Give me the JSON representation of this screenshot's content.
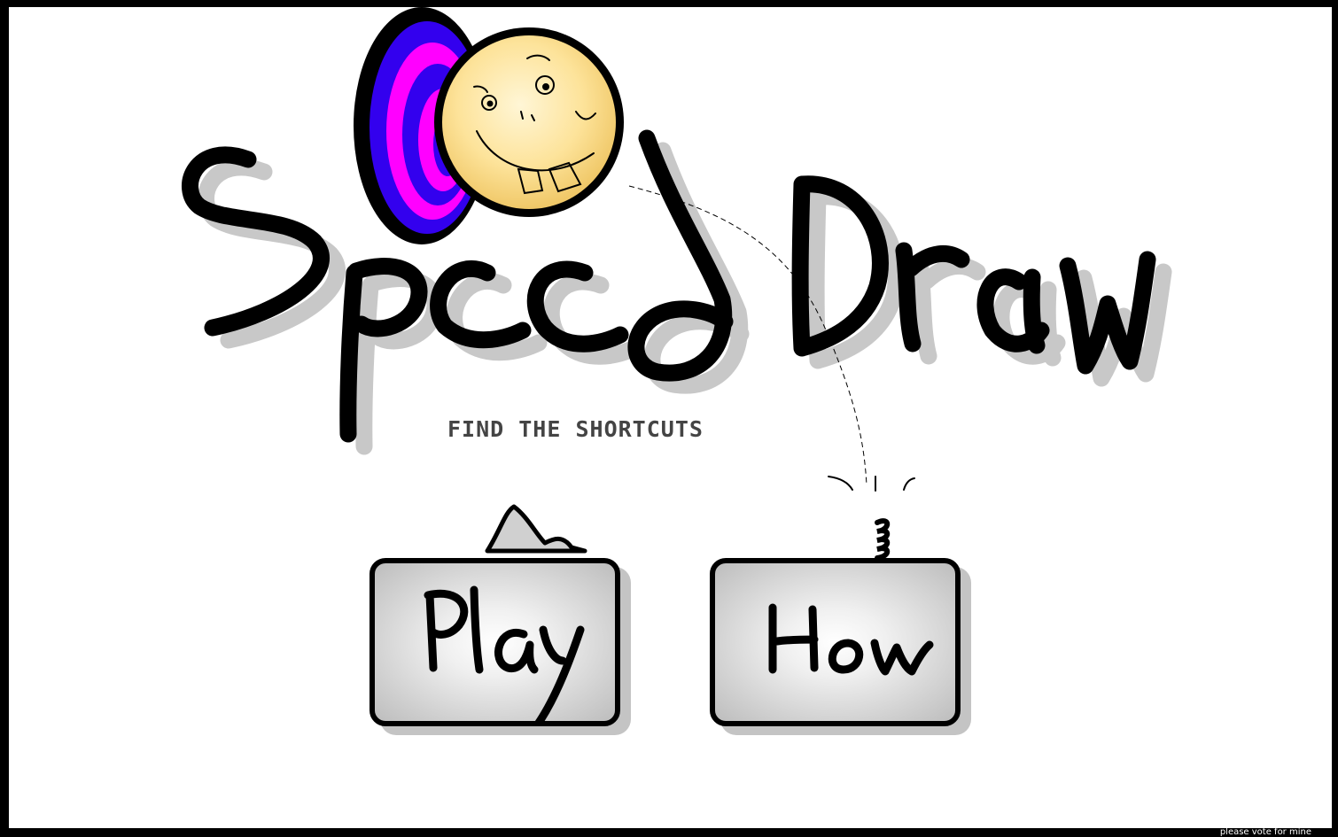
{
  "game": {
    "title": "Speed Draw",
    "subtitle": "FIND THE SHORTCUTS",
    "footer_note": "please vote for mine"
  },
  "menu": {
    "play_label": "Play",
    "how_label": "How"
  },
  "colors": {
    "background": "#ffffff",
    "frame": "#000000",
    "ink": "#000000",
    "shadow": "#c4c4c4",
    "portal_outer": "#3300ee",
    "portal_ring": "#ff00ff",
    "face_fill": "#fde39a"
  },
  "icons": {
    "portal": "swirl-portal-icon",
    "face": "smiley-face-icon",
    "shark_fin": "shark-fin-icon",
    "spring": "spring-icon"
  }
}
